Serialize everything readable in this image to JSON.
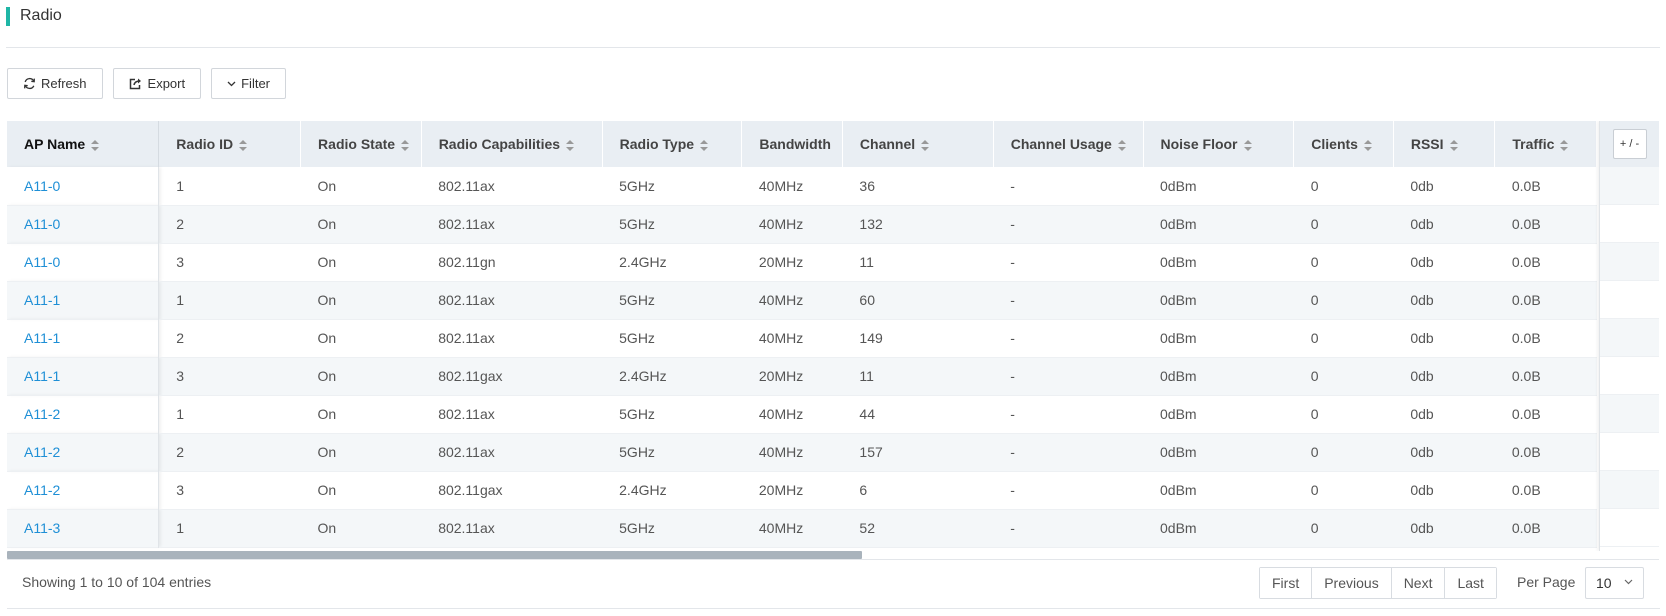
{
  "page": {
    "title": "Radio"
  },
  "colors": {
    "accent": "#1fb6a6",
    "link": "#1e8fd6",
    "header_bg": "#e9eef3"
  },
  "toolbar": {
    "refresh_label": "Refresh",
    "export_label": "Export",
    "filter_label": "Filter"
  },
  "table": {
    "columns": [
      "AP Name",
      "Radio ID",
      "Radio State",
      "Radio Capabilities",
      "Radio Type",
      "Bandwidth",
      "Channel",
      "Channel Usage",
      "Noise Floor",
      "Clients",
      "RSSI",
      "Traffic"
    ],
    "column_toggle_label": "+ / -",
    "rows": [
      [
        "A11-0",
        "1",
        "On",
        "802.11ax",
        "5GHz",
        "40MHz",
        "36",
        "-",
        "0dBm",
        "0",
        "0db",
        "0.0B"
      ],
      [
        "A11-0",
        "2",
        "On",
        "802.11ax",
        "5GHz",
        "40MHz",
        "132",
        "-",
        "0dBm",
        "0",
        "0db",
        "0.0B"
      ],
      [
        "A11-0",
        "3",
        "On",
        "802.11gn",
        "2.4GHz",
        "20MHz",
        "11",
        "-",
        "0dBm",
        "0",
        "0db",
        "0.0B"
      ],
      [
        "A11-1",
        "1",
        "On",
        "802.11ax",
        "5GHz",
        "40MHz",
        "60",
        "-",
        "0dBm",
        "0",
        "0db",
        "0.0B"
      ],
      [
        "A11-1",
        "2",
        "On",
        "802.11ax",
        "5GHz",
        "40MHz",
        "149",
        "-",
        "0dBm",
        "0",
        "0db",
        "0.0B"
      ],
      [
        "A11-1",
        "3",
        "On",
        "802.11gax",
        "2.4GHz",
        "20MHz",
        "11",
        "-",
        "0dBm",
        "0",
        "0db",
        "0.0B"
      ],
      [
        "A11-2",
        "1",
        "On",
        "802.11ax",
        "5GHz",
        "40MHz",
        "44",
        "-",
        "0dBm",
        "0",
        "0db",
        "0.0B"
      ],
      [
        "A11-2",
        "2",
        "On",
        "802.11ax",
        "5GHz",
        "40MHz",
        "157",
        "-",
        "0dBm",
        "0",
        "0db",
        "0.0B"
      ],
      [
        "A11-2",
        "3",
        "On",
        "802.11gax",
        "2.4GHz",
        "20MHz",
        "6",
        "-",
        "0dBm",
        "0",
        "0db",
        "0.0B"
      ],
      [
        "A11-3",
        "1",
        "On",
        "802.11ax",
        "5GHz",
        "40MHz",
        "52",
        "-",
        "0dBm",
        "0",
        "0db",
        "0.0B"
      ]
    ]
  },
  "footer": {
    "entries_text": "Showing 1 to 10 of 104 entries",
    "pager": [
      "First",
      "Previous",
      "Next",
      "Last"
    ],
    "per_page_label": "Per Page",
    "per_page_value": "10"
  }
}
